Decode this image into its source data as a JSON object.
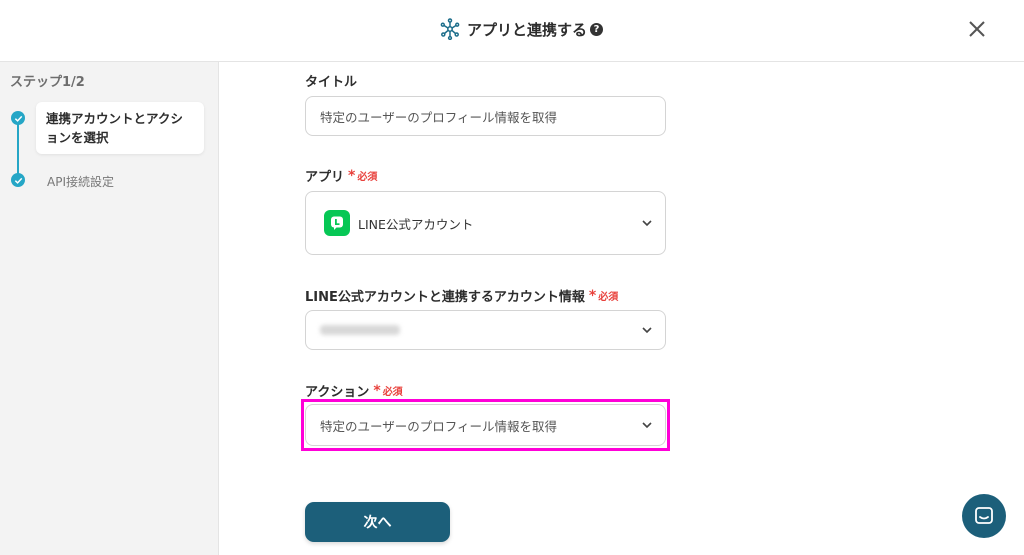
{
  "header": {
    "title": "アプリと連携する",
    "help_icon": "question-circle-icon",
    "close_icon": "close-icon"
  },
  "sidebar": {
    "step_count": "ステップ1/2",
    "steps": [
      {
        "label": "連携アカウントとアクションを選択",
        "status": "current"
      },
      {
        "label": "API接続設定",
        "status": "pending"
      }
    ]
  },
  "form": {
    "required_text": "必須",
    "title_field": {
      "label": "タイトル",
      "value": "特定のユーザーのプロフィール情報を取得"
    },
    "app_field": {
      "label": "アプリ",
      "value": "LINE公式アカウント"
    },
    "account_field": {
      "label": "LINE公式アカウントと連携するアカウント情報"
    },
    "action_field": {
      "label": "アクション",
      "value": "特定のユーザーのプロフィール情報を取得"
    },
    "next_button": "次へ"
  },
  "colors": {
    "accent": "#25a6c6",
    "primary_button": "#1c5f7a",
    "required": "#e8413c",
    "highlight": "#ff00d8",
    "line_green": "#06c755"
  }
}
